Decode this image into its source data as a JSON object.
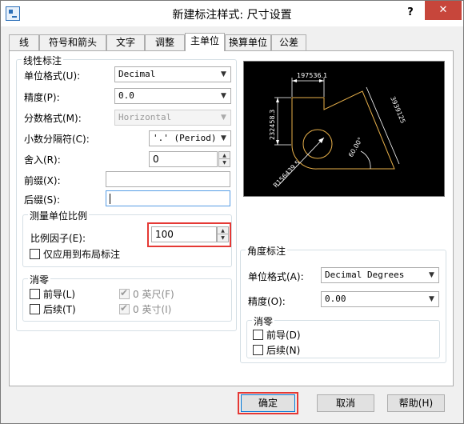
{
  "window": {
    "title": "新建标注样式: 尺寸设置",
    "help_glyph": "?",
    "close_glyph": "✕"
  },
  "tabs": [
    "线",
    "符号和箭头",
    "文字",
    "调整",
    "主单位",
    "换算单位",
    "公差"
  ],
  "active_tab": "主单位",
  "linear": {
    "group_title": "线性标注",
    "unit_format": {
      "label": "单位格式(U):",
      "value": "Decimal"
    },
    "precision": {
      "label": "精度(P):",
      "value": "0.0"
    },
    "fraction_format": {
      "label": "分数格式(M):",
      "value": "Horizontal"
    },
    "decimal_separator": {
      "label": "小数分隔符(C):",
      "value": "'.' (Period)"
    },
    "round_off": {
      "label": "舍入(R):",
      "value": "0"
    },
    "prefix": {
      "label": "前缀(X):",
      "value": ""
    },
    "suffix": {
      "label": "后缀(S):",
      "value": ""
    }
  },
  "scale": {
    "group_title": "测量单位比例",
    "factor": {
      "label": "比例因子(E):",
      "value": "100"
    },
    "layout_only": {
      "label": "仅应用到布局标注",
      "checked": false
    }
  },
  "zero_suppression_linear": {
    "group_title": "消零",
    "leading": {
      "label": "前导(L)",
      "checked": false
    },
    "trailing": {
      "label": "后续(T)",
      "checked": false
    },
    "feet": {
      "label": "0 英尺(F)",
      "checked": true
    },
    "inches": {
      "label": "0 英寸(I)",
      "checked": true
    }
  },
  "preview": {
    "dim_top": "197536.1",
    "dim_left": "232458.3",
    "dim_right": "3939125",
    "dim_angle": "60.00°",
    "dim_radius": "R156439.5",
    "line_color": "#e8b04a",
    "text_color": "#ffffff"
  },
  "angular": {
    "group_title": "角度标注",
    "unit_format": {
      "label": "单位格式(A):",
      "value": "Decimal Degrees"
    },
    "precision": {
      "label": "精度(O):",
      "value": "0.00"
    },
    "zero_group_title": "消零",
    "leading": {
      "label": "前导(D)",
      "checked": false
    },
    "trailing": {
      "label": "后续(N)",
      "checked": false
    }
  },
  "buttons": {
    "ok": "确定",
    "cancel": "取消",
    "help": "帮助(H)"
  },
  "accent": {
    "highlight": "#e53935"
  }
}
